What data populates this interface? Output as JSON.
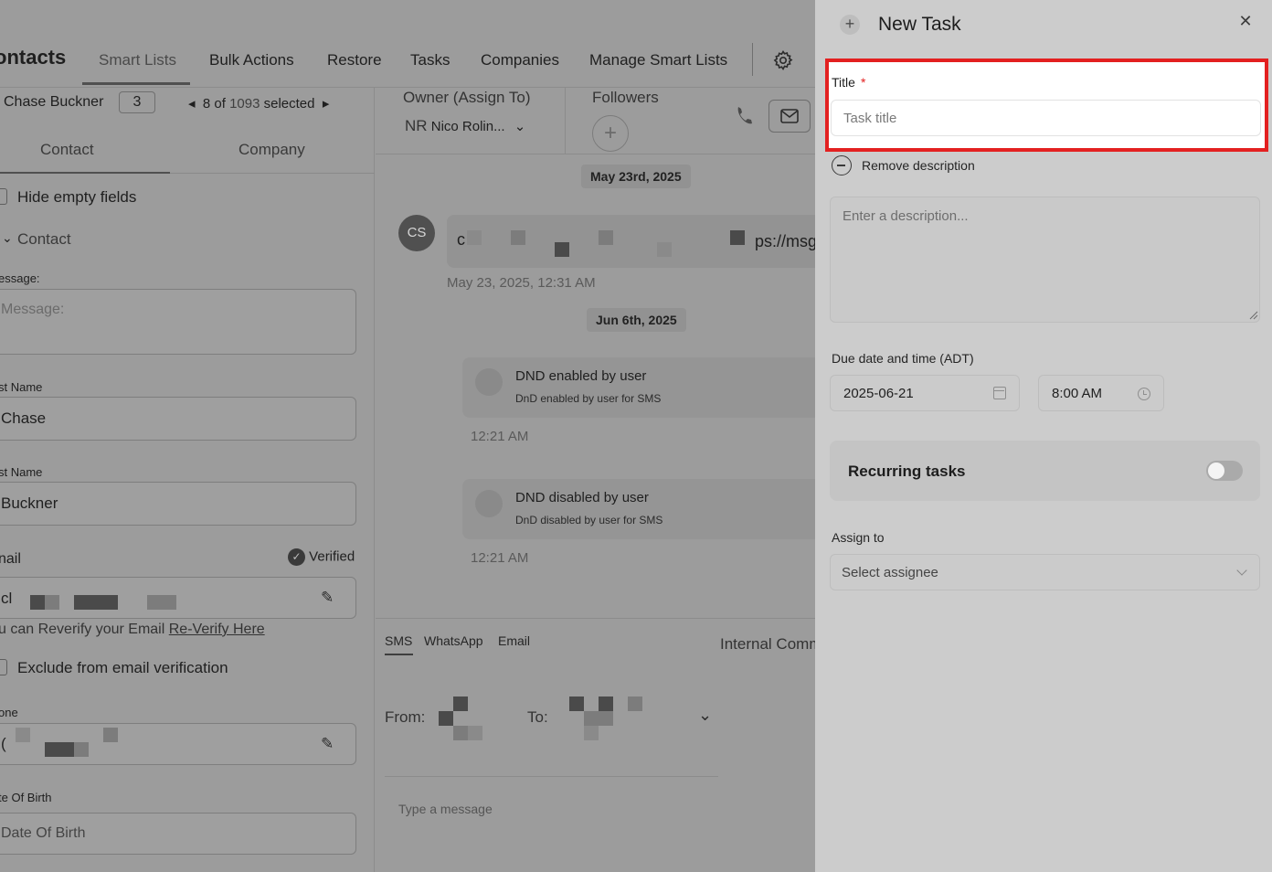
{
  "nav": {
    "brand": "ontacts",
    "tabs": [
      "Smart Lists",
      "Bulk Actions",
      "Restore",
      "Tasks",
      "Companies",
      "Manage Smart Lists"
    ]
  },
  "contact_header": {
    "name": "Chase Buckner",
    "count": "3",
    "pager_prefix": "8 of",
    "pager_total": "1093",
    "pager_suffix": "selected"
  },
  "left_tabs": [
    "Contact",
    "Company"
  ],
  "left_panel": {
    "hide_empty": "Hide empty fields",
    "section": "Contact",
    "message_label": "essage:",
    "message_placeholder": "Message:",
    "first_name_label": "st Name",
    "first_name_value": "Chase",
    "last_name_label": "st Name",
    "last_name_value": "Buckner",
    "email_label": "nail",
    "verified": "Verified",
    "email_value_start": "cl",
    "reverify_text": "u can Reverify your Email",
    "reverify_link": "Re-Verify Here",
    "exclude_label": "Exclude from email verification",
    "phone_label": "one",
    "phone_value_start": "(",
    "dob_label": "te Of Birth",
    "dob_placeholder": "Date Of Birth"
  },
  "center": {
    "owner_label": "Owner (Assign To)",
    "owner_initials": "NR",
    "owner_name": "Nico Rolin...",
    "followers_label": "Followers",
    "date1": "May 23rd, 2025",
    "avatar_initials": "CS",
    "bubble_start": "c",
    "bubble_end": "ps://msg",
    "bubble_time": "May 23, 2025, 12:31 AM",
    "date2": "Jun 6th, 2025",
    "activity1_title": "DND enabled by user",
    "activity1_sub": "DnD enabled by user for SMS",
    "activity1_time": "12:21 AM",
    "activity2_title": "DND disabled by user",
    "activity2_sub": "DnD disabled by user for SMS",
    "activity2_time": "12:21 AM",
    "composer_tabs": [
      "SMS",
      "WhatsApp",
      "Email"
    ],
    "internal": "Internal Comm",
    "from_label": "From:",
    "to_label": "To:",
    "type_message": "Type a message"
  },
  "drawer": {
    "title": "New Task",
    "title_label": "Title",
    "required_mark": "*",
    "title_placeholder": "Task title",
    "remove_description": "Remove description",
    "description_placeholder": "Enter a description...",
    "due_label": "Due date and time (ADT)",
    "due_date": "2025-06-21",
    "due_time": "8:00 AM",
    "recurring_label": "Recurring tasks",
    "recurring_on": false,
    "assign_label": "Assign to",
    "assign_placeholder": "Select assignee"
  },
  "colors": {
    "highlight": "#e32020",
    "overlay": "#9c9c9c",
    "drawer_bg": "#cccccc"
  }
}
